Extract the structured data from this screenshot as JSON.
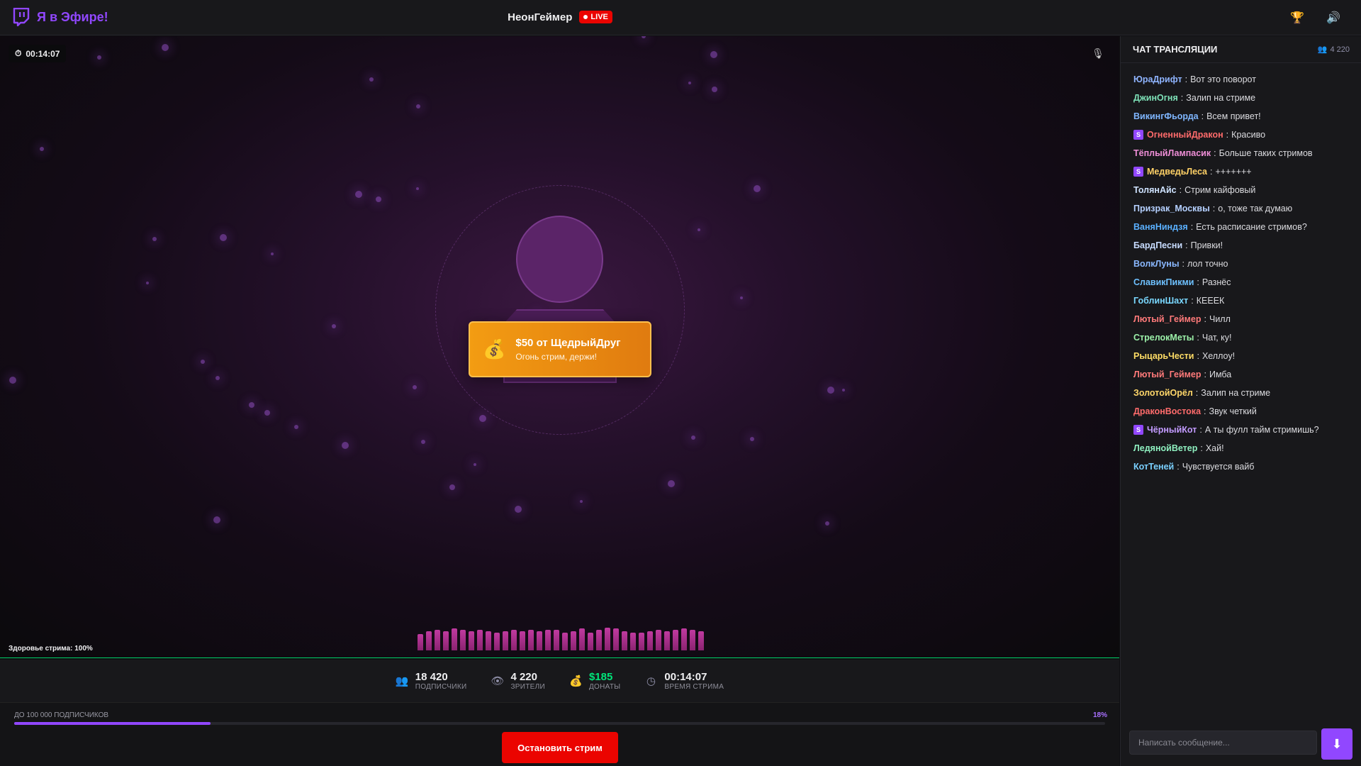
{
  "header": {
    "app_name": "Я в Эфире!",
    "streamer_name": "НеонГеймер",
    "live_label": "LIVE"
  },
  "stage": {
    "timer": "00:14:07",
    "donation": {
      "title": "$50 от ЩедрыйДруг",
      "message": "Огонь стрим, держи!"
    },
    "health_label": "Здоровье стрима: 100%",
    "health_value": 1.0,
    "equalizer_levels": [
      0.65,
      0.75,
      0.8,
      0.75,
      0.85,
      0.8,
      0.75,
      0.8,
      0.75,
      0.7,
      0.75,
      0.8,
      0.75,
      0.8,
      0.75,
      0.8,
      0.8,
      0.7,
      0.75,
      0.85,
      0.7,
      0.8,
      0.9,
      0.85,
      0.75,
      0.7,
      0.7,
      0.75,
      0.8,
      0.75,
      0.8,
      0.85,
      0.8,
      0.75
    ]
  },
  "stats": [
    {
      "icon": "users-icon",
      "glyph": "👥",
      "value": "18 420",
      "label": "ПОДПИСЧИКИ",
      "accent": ""
    },
    {
      "icon": "eye-icon",
      "glyph": "👁",
      "value": "4 220",
      "label": "ЗРИТЕЛИ",
      "accent": ""
    },
    {
      "icon": "money-bag-icon",
      "glyph": "💰",
      "value": "$185",
      "label": "ДОНАТЫ",
      "accent": "green"
    },
    {
      "icon": "clock-icon",
      "glyph": "◷",
      "value": "00:14:07",
      "label": "ВРЕМЯ СТРИМА",
      "accent": ""
    }
  ],
  "goal": {
    "label": "ДО 100 000 ПОДПИСЧИКОВ",
    "percent_label": "18%",
    "progress": 0.18
  },
  "controls": {
    "stop_label": "Остановить стрим"
  },
  "chat": {
    "title": "ЧАТ ТРАНСЛЯЦИИ",
    "viewer_count": "4 220",
    "input_placeholder": "Написать сообщение...",
    "messages": [
      {
        "user": "ЮраДрифт",
        "color": "#8fb4ff",
        "text": "Вот это поворот",
        "sub": false
      },
      {
        "user": "ДжинОгня",
        "color": "#7ee2b8",
        "text": "Залип на стриме",
        "sub": false
      },
      {
        "user": "ВикингФьорда",
        "color": "#7fb6ff",
        "text": "Всем привет!",
        "sub": false
      },
      {
        "user": "ОгненныйДракон",
        "color": "#ff6b6b",
        "text": "Красиво",
        "sub": true
      },
      {
        "user": "ТёплыйЛампасик",
        "color": "#f08fd8",
        "text": "Больше таких стримов",
        "sub": false
      },
      {
        "user": "МедведьЛеса",
        "color": "#ffd166",
        "text": "+++++++",
        "sub": true
      },
      {
        "user": "ТолянАйс",
        "color": "#cfe3ff",
        "text": "Стрим кайфовый",
        "sub": false
      },
      {
        "user": "Призрак_Москвы",
        "color": "#b5d0ff",
        "text": "о, тоже так думаю",
        "sub": false
      },
      {
        "user": "ВаняНиндзя",
        "color": "#5ab0ff",
        "text": "Есть расписание стримов?",
        "sub": false
      },
      {
        "user": "БардПесни",
        "color": "#c8dcff",
        "text": "Привки!",
        "sub": false
      },
      {
        "user": "ВолкЛуны",
        "color": "#8ab8ff",
        "text": "лол точно",
        "sub": false
      },
      {
        "user": "СлавикПикми",
        "color": "#6ec1ff",
        "text": "Разнёс",
        "sub": false
      },
      {
        "user": "ГоблинШахт",
        "color": "#7ad8ff",
        "text": "КЕЕЕК",
        "sub": false
      },
      {
        "user": "Лютый_Геймер",
        "color": "#ff7a7a",
        "text": "Чилл",
        "sub": false
      },
      {
        "user": "СтрелокМеты",
        "color": "#9bf0a8",
        "text": "Чат, ку!",
        "sub": false
      },
      {
        "user": "РыцарьЧести",
        "color": "#ffdd66",
        "text": "Хеллоу!",
        "sub": false
      },
      {
        "user": "Лютый_Геймер",
        "color": "#ff7a7a",
        "text": "Имба",
        "sub": false
      },
      {
        "user": "ЗолотойОрёл",
        "color": "#ffd76a",
        "text": "Залип на стриме",
        "sub": false
      },
      {
        "user": "ДраконВостока",
        "color": "#ff6b6b",
        "text": "Звук четкий",
        "sub": false
      },
      {
        "user": "ЧёрныйКот",
        "color": "#c39bff",
        "text": "А ты фулл тайм стримишь?",
        "sub": true
      },
      {
        "user": "ЛедянойВетер",
        "color": "#8ff0c0",
        "text": "Хай!",
        "sub": false
      },
      {
        "user": "КотТеней",
        "color": "#7ad0ff",
        "text": "Чувствуется вайб",
        "sub": false
      }
    ]
  }
}
